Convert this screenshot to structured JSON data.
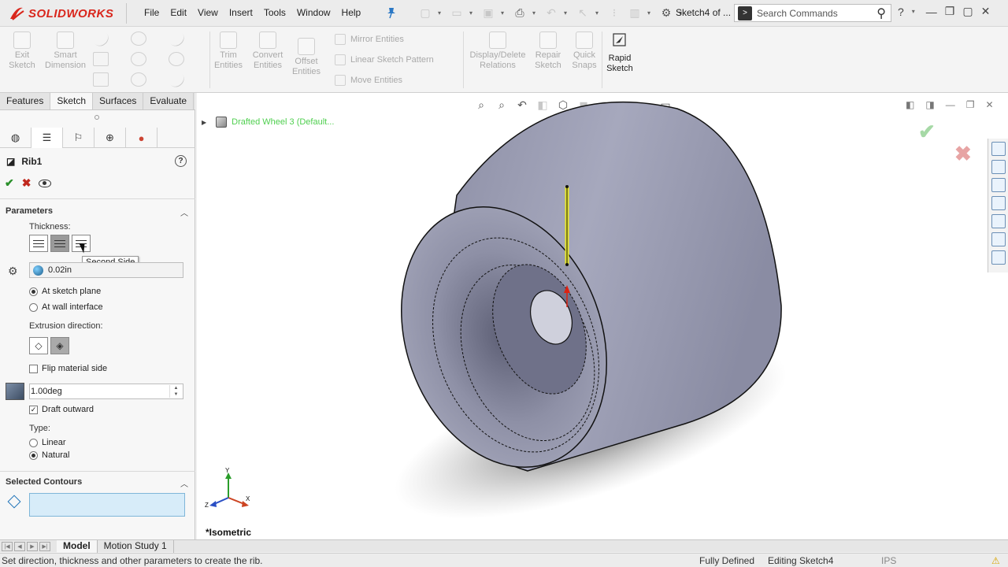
{
  "app": {
    "logo_text": "SOLIDWORKS",
    "menus": [
      "File",
      "Edit",
      "View",
      "Insert",
      "Tools",
      "Window",
      "Help"
    ],
    "doc_title": "Sketch4 of ...",
    "search_placeholder": "Search Commands"
  },
  "command_manager": {
    "exit_sketch": "Exit Sketch",
    "smart_dimension": "Smart Dimension",
    "trim_entities": "Trim Entities",
    "convert_entities": "Convert Entities",
    "offset_entities": "Offset Entities",
    "mirror_entities": "Mirror Entities",
    "linear_sketch_pattern": "Linear Sketch Pattern",
    "move_entities": "Move Entities",
    "display_delete_relations": "Display/Delete Relations",
    "repair_sketch": "Repair Sketch",
    "quick_snaps": "Quick Snaps",
    "rapid_sketch": "Rapid Sketch"
  },
  "cm_tabs": [
    "Features",
    "Sketch",
    "Surfaces",
    "Evaluate"
  ],
  "property_manager": {
    "feature_name": "Rib1",
    "parameters": {
      "title": "Parameters",
      "thickness_label": "Thickness:",
      "tooltip": "Second Side",
      "thickness_value": "0.02in",
      "at_sketch_plane": "At sketch plane",
      "at_wall_interface": "At wall interface",
      "extrusion_direction_label": "Extrusion direction:",
      "flip_material_side": "Flip material side",
      "draft_value": "1.00deg",
      "draft_outward": "Draft outward",
      "type_label": "Type:",
      "type_linear": "Linear",
      "type_natural": "Natural"
    },
    "selected_contours": {
      "title": "Selected Contours"
    }
  },
  "graphics": {
    "tree_flyout": "Drafted Wheel 3  (Default...",
    "view_label": "*Isometric",
    "triad": {
      "y": "Y",
      "z": "Z",
      "x": "X"
    }
  },
  "bottom_tabs": [
    "Model",
    "Motion Study 1"
  ],
  "status": {
    "message": "Set direction, thickness and other parameters to create the rib.",
    "definition": "Fully Defined",
    "editing": "Editing Sketch4",
    "units": "IPS"
  },
  "colors": {
    "brand_red": "#d9261c",
    "sketch_line": "#e8e82a",
    "tree_green": "#4fcf4f",
    "selection_box": "#d7ecf9"
  }
}
